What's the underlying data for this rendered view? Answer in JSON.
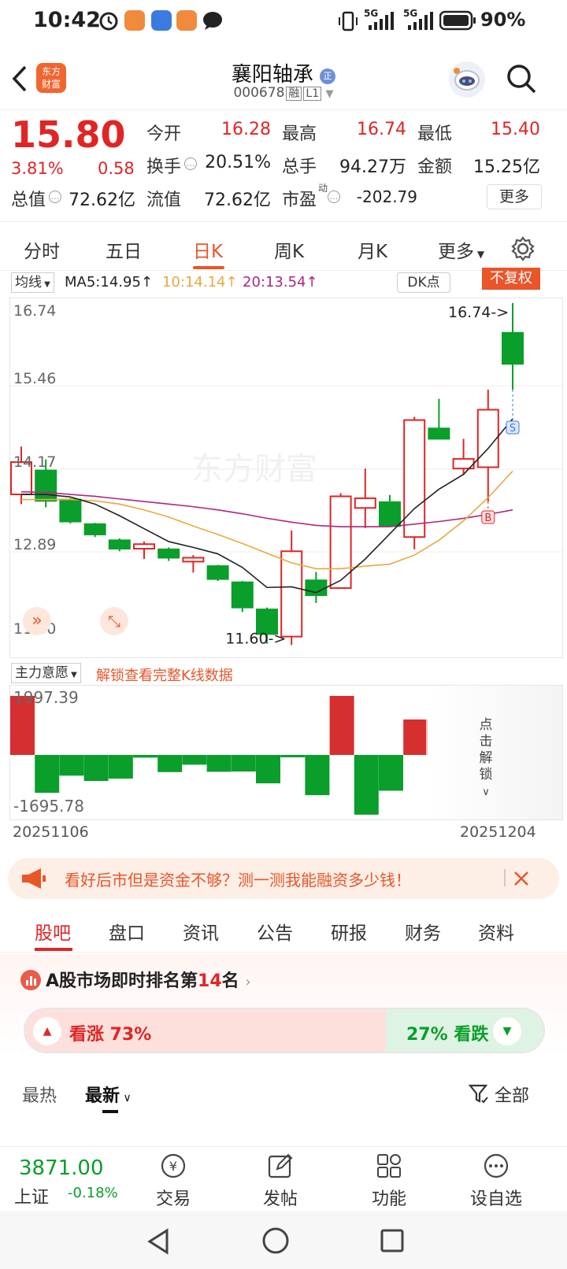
{
  "status_bar": {
    "time": "10:42",
    "network_1": "5G",
    "network_2": "5G",
    "battery": "90%"
  },
  "header": {
    "logo_text": "东方\n财富",
    "stock_name": "襄阳轴承",
    "stock_badge": "正",
    "stock_code": "000678",
    "tag_margin": "融",
    "tag_level": "L1"
  },
  "quote": {
    "price": "15.80",
    "change_pct": "3.81%",
    "change_abs": "0.58",
    "total_value_label": "总值",
    "total_value": "72.62亿",
    "open_label": "今开",
    "open": "16.28",
    "high_label": "最高",
    "high": "16.74",
    "low_label": "最低",
    "low": "15.40",
    "turnover_label": "换手",
    "turnover": "20.51%",
    "volume_label": "总手",
    "volume": "94.27万",
    "amount_label": "金额",
    "amount": "15.25亿",
    "float_value_label": "流值",
    "float_value": "72.62亿",
    "pe_label": "市盈",
    "pe_sup": "动",
    "pe": "-202.79",
    "more_button": "更多"
  },
  "period_tabs": {
    "items": [
      "分时",
      "五日",
      "日K",
      "周K",
      "月K",
      "更多"
    ],
    "active": "日K"
  },
  "chart_bar": {
    "ma_select": "均线",
    "ma5": "MA5:14.95↑",
    "ma10": "10:14.14↑",
    "ma20": "20:13.54↑",
    "dk_button": "DK点",
    "adjust_button": "不复权",
    "colors": {
      "ma5": "#222222",
      "ma10": "#e8a93c",
      "ma20": "#b0267f",
      "up": "#e02525",
      "down": "#0a9e2a"
    }
  },
  "chart_data": [
    {
      "type": "candlestick",
      "title": "",
      "y_ticks": [
        "16.74",
        "15.46",
        "14.17",
        "12.89",
        "11.60"
      ],
      "ylim": [
        11.6,
        16.74
      ],
      "watermark": "东方财富",
      "high_marker": "16.74->",
      "low_marker": "11.60->",
      "buy_marker": "B",
      "sell_marker": "S",
      "candles": [
        {
          "o": 13.78,
          "h": 14.52,
          "l": 13.63,
          "c": 14.28
        },
        {
          "o": 14.15,
          "h": 14.32,
          "l": 13.58,
          "c": 13.68
        },
        {
          "o": 13.7,
          "h": 13.72,
          "l": 13.33,
          "c": 13.36
        },
        {
          "o": 13.32,
          "h": 13.34,
          "l": 13.12,
          "c": 13.16
        },
        {
          "o": 13.07,
          "h": 13.1,
          "l": 12.9,
          "c": 12.94
        },
        {
          "o": 12.94,
          "h": 13.05,
          "l": 12.78,
          "c": 13.01
        },
        {
          "o": 12.93,
          "h": 12.96,
          "l": 12.75,
          "c": 12.8
        },
        {
          "o": 12.74,
          "h": 12.84,
          "l": 12.57,
          "c": 12.8
        },
        {
          "o": 12.67,
          "h": 12.69,
          "l": 12.44,
          "c": 12.47
        },
        {
          "o": 12.42,
          "h": 12.44,
          "l": 11.96,
          "c": 12.03
        },
        {
          "o": 12.0,
          "h": 12.03,
          "l": 11.47,
          "c": 11.62
        },
        {
          "o": 11.58,
          "h": 13.22,
          "l": 11.45,
          "c": 12.9
        },
        {
          "o": 12.45,
          "h": 12.58,
          "l": 12.1,
          "c": 12.22
        },
        {
          "o": 12.33,
          "h": 13.8,
          "l": 12.33,
          "c": 13.75
        },
        {
          "o": 13.57,
          "h": 14.18,
          "l": 13.26,
          "c": 13.72
        },
        {
          "o": 13.66,
          "h": 13.77,
          "l": 13.36,
          "c": 13.29
        },
        {
          "o": 13.12,
          "h": 14.98,
          "l": 12.93,
          "c": 14.93
        },
        {
          "o": 14.8,
          "h": 15.26,
          "l": 14.77,
          "c": 14.64
        },
        {
          "o": 14.18,
          "h": 14.64,
          "l": 14.08,
          "c": 14.33
        },
        {
          "o": 14.2,
          "h": 15.4,
          "l": 13.67,
          "c": 15.09
        },
        {
          "o": 16.28,
          "h": 16.74,
          "l": 15.4,
          "c": 15.8
        }
      ],
      "ma5": [
        13.78,
        13.78,
        13.74,
        13.63,
        13.45,
        13.25,
        13.05,
        12.96,
        12.86,
        12.65,
        12.34,
        12.35,
        12.26,
        12.45,
        12.78,
        13.17,
        13.56,
        13.86,
        14.09,
        14.49,
        14.95
      ],
      "ma10": [
        13.7,
        13.7,
        13.7,
        13.68,
        13.63,
        13.54,
        13.43,
        13.29,
        13.16,
        13.02,
        12.87,
        12.72,
        12.63,
        12.63,
        12.67,
        12.7,
        12.84,
        13.07,
        13.37,
        13.73,
        14.14
      ],
      "ma20": [
        13.82,
        13.81,
        13.78,
        13.75,
        13.71,
        13.67,
        13.63,
        13.59,
        13.54,
        13.48,
        13.41,
        13.35,
        13.3,
        13.28,
        13.28,
        13.28,
        13.32,
        13.36,
        13.41,
        13.47,
        13.54
      ]
    },
    {
      "type": "bar",
      "title": "",
      "series_name": "主力意愿",
      "y_ticks": [
        "1997.39",
        "-1695.78"
      ],
      "ylim": [
        -1695.78,
        1997.39
      ],
      "values": [
        1997,
        -1280,
        -700,
        -880,
        -800,
        -90,
        -580,
        -330,
        -570,
        -560,
        -960,
        -80,
        -1360,
        1997,
        -2020,
        -1210,
        1200
      ],
      "x_start": "20251106",
      "x_end": "20251204",
      "locked_text": "点击解锁"
    }
  ],
  "indicator_bar": {
    "select": "主力意愿",
    "unlock_link": "解锁查看完整K线数据"
  },
  "banner": {
    "text": "看好后市但是资金不够？测一测我能融资多少钱！"
  },
  "bottom_tabs": {
    "items": [
      "股吧",
      "盘口",
      "资讯",
      "公告",
      "研报",
      "财务",
      "资料"
    ],
    "active": "股吧"
  },
  "rank": {
    "prefix": "A股市场即时排名第",
    "number": "14",
    "suffix": "名",
    "bull": "看涨 73%",
    "bear": "27% 看跌",
    "bull_pct": 73
  },
  "sort": {
    "hot": "最热",
    "new": "最新",
    "filter": "全部"
  },
  "footer": {
    "index_value": "3871.00",
    "index_name": "上证",
    "index_change": "-0.18%",
    "items": [
      "交易",
      "发帖",
      "功能",
      "设自选"
    ]
  }
}
